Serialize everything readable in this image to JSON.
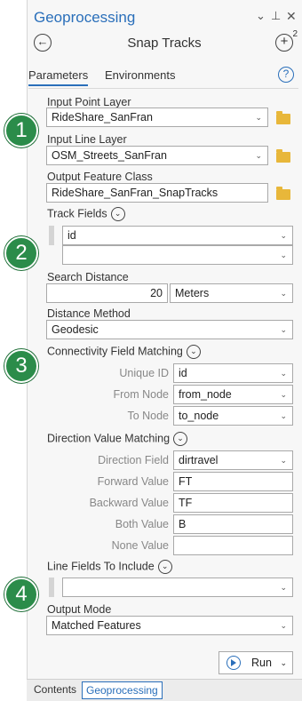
{
  "window": {
    "title": "Geoprocessing",
    "pin_icon": "pin-icon",
    "close_icon": "close-icon",
    "menu_icon": "chevron-down-icon"
  },
  "header": {
    "tool_title": "Snap Tracks",
    "add_badge": "2"
  },
  "tabs": {
    "parameters": "Parameters",
    "environments": "Environments",
    "help": "?"
  },
  "params": {
    "input_point_layer": {
      "label": "Input Point Layer",
      "value": "RideShare_SanFran"
    },
    "input_line_layer": {
      "label": "Input Line Layer",
      "value": "OSM_Streets_SanFran"
    },
    "output_feature_class": {
      "label": "Output Feature Class",
      "value": "RideShare_SanFran_SnapTracks"
    },
    "track_fields": {
      "label": "Track Fields",
      "values": [
        "id",
        ""
      ]
    },
    "search_distance": {
      "label": "Search Distance",
      "value": "20",
      "unit": "Meters"
    },
    "distance_method": {
      "label": "Distance Method",
      "value": "Geodesic"
    },
    "connectivity": {
      "label": "Connectivity Field Matching",
      "unique_id": {
        "label": "Unique ID",
        "value": "id"
      },
      "from_node": {
        "label": "From Node",
        "value": "from_node"
      },
      "to_node": {
        "label": "To Node",
        "value": "to_node"
      }
    },
    "direction": {
      "label": "Direction Value Matching",
      "direction_field": {
        "label": "Direction Field",
        "value": "dirtravel"
      },
      "forward_value": {
        "label": "Forward Value",
        "value": "FT"
      },
      "backward_value": {
        "label": "Backward Value",
        "value": "TF"
      },
      "both_value": {
        "label": "Both Value",
        "value": "B"
      },
      "none_value": {
        "label": "None Value",
        "value": ""
      }
    },
    "line_fields": {
      "label": "Line Fields To Include",
      "value": ""
    },
    "output_mode": {
      "label": "Output Mode",
      "value": "Matched Features"
    }
  },
  "run_button": {
    "label": "Run"
  },
  "bottom_tabs": {
    "contents": "Contents",
    "geoprocessing": "Geoprocessing"
  },
  "badges": [
    "1",
    "2",
    "3",
    "4"
  ],
  "colors": {
    "accent": "#2a6fba",
    "badge": "#2b8c4a",
    "folder": "#e8b73a"
  }
}
